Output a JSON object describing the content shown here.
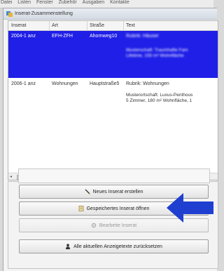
{
  "menubar": {
    "items": [
      "Datei",
      "Listen",
      "Fenster",
      "Zubehör",
      "Ausgaben",
      "Kontakte"
    ]
  },
  "window": {
    "title": "Inserat-Zusammenstellung"
  },
  "table": {
    "columns": [
      "Inserat",
      "Art",
      "Straße",
      "Text"
    ],
    "rows": [
      {
        "inserat": "2004-1 anz",
        "art": "EFH-ZFH",
        "strasse": "Ahornweg10",
        "text": "Rubrik: Häuser",
        "detail_lines": [
          "Musterschaft: Traumhafte Fam",
          "Lifetime, 155 m² Wohnfläche"
        ],
        "selected": true
      },
      {
        "inserat": "2006-1 anz",
        "art": "Wohnungen",
        "strasse": "Hauptstraße5",
        "text": "Rubrik: Wohnungen",
        "detail_lines": [
          "Musterortschaft: Luxus-Penthous",
          "5 Zimmer, 180 m² Wohnfläche, 1"
        ],
        "selected": false
      }
    ]
  },
  "buttons": {
    "new_ad": "Neues Inserat erstellen",
    "open_saved": "Gespeichertes Inserat öffnen",
    "edit": "Bearbeite Inserat",
    "reset_all": "Alle aktuellen Anzeigetexte zurücksetzen"
  },
  "colors": {
    "selection": "#1f1fe8",
    "pointer_arrow": "#1f3fd0"
  },
  "icons": [
    "app-icon",
    "pencil-icon",
    "document-icon",
    "gear-icon",
    "person-icon",
    "pointer-arrow-icon"
  ]
}
